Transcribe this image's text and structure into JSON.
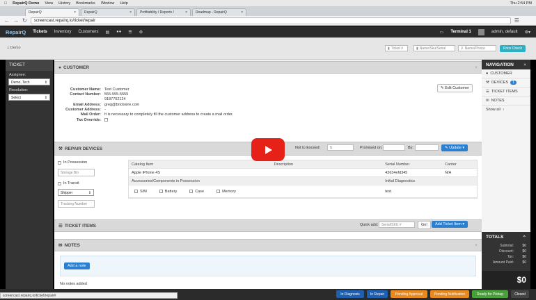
{
  "mac_bar": {
    "app": "RepairQ Demo",
    "menu": [
      "View",
      "History",
      "Bookmarks",
      "Window",
      "Help"
    ],
    "right": [
      "Thu 2:54 PM"
    ]
  },
  "browser": {
    "tabs": [
      "RepairQ",
      "RepairQ",
      "Profitability / Reports /",
      "Roadmap - RepairQ"
    ],
    "url": "screencast.repairq.io/ticket/repair",
    "status_url": "screencast.repairq.io/ticket/repair#"
  },
  "appnav": {
    "brand": "RepairQ",
    "items": [
      "Tickets",
      "Inventory",
      "Customers"
    ],
    "terminal": "Terminal 1",
    "user": "admin, default"
  },
  "toolbar": {
    "crumb": "Demo",
    "ticket_placeholder": "Ticket #",
    "sku_placeholder": "Name/Sku/Serial",
    "phone_placeholder": "Name/Phone",
    "price_check": "Price Check"
  },
  "ticket_panel": {
    "title": "TICKET",
    "assignee_label": "Assignee:",
    "assignee_value": "Demo, Tech",
    "resolution_label": "Resolution:",
    "resolution_value": "Select"
  },
  "customer": {
    "title": "CUSTOMER",
    "edit_button": "Edit Customer",
    "fields": [
      {
        "k": "Customer Name:",
        "v": "Test Customer"
      },
      {
        "k": "Contact Number:",
        "v": "555-555-5555"
      },
      {
        "k": "",
        "v": "9187702124"
      },
      {
        "k": "Email Address:",
        "v": "greg@brickwire.com"
      },
      {
        "k": "Customer Address:",
        "v": "-"
      },
      {
        "k": "Mail Order:",
        "v": "It is necessary to completely fill the customer address to create a mail order."
      },
      {
        "k": "Tax Override:",
        "v": ""
      }
    ]
  },
  "repair_devices": {
    "title": "REPAIR DEVICES",
    "not_to_exceed": "Not to Exceed:",
    "promised_on": "Promised on:",
    "by": "By:",
    "update": "Update",
    "in_possession": "In Possession",
    "storage_bin": "Storage Bin",
    "in_transit": "In Transit",
    "shipper": "Shipper",
    "tracking": "Tracking Number",
    "table": {
      "headers": [
        "Catalog Item",
        "Description",
        "Serial Number",
        "Carrier"
      ],
      "row": [
        "Apple iPhone 4S",
        "",
        "43634efd345",
        "N/A"
      ],
      "sub_headers": [
        "Accessories/Components in Possession",
        "Initial Diagnostics"
      ],
      "accessories": [
        "SIM",
        "Battery",
        "Case",
        "Memory"
      ],
      "diagnostics": "test"
    }
  },
  "ticket_items": {
    "title": "TICKET ITEMS",
    "quick_add": "Quick add:",
    "quick_placeholder": "Serial/SKU #",
    "go": "Go!",
    "add": "Add Ticket Item"
  },
  "notes": {
    "title": "NOTES",
    "add": "Add a note",
    "empty": "No notes added"
  },
  "navigation": {
    "title": "NAVIGATION",
    "items": [
      "CUSTOMER",
      "DEVICES",
      "TICKET ITEMS",
      "NOTES"
    ],
    "device_count": "1",
    "show_all": "Show all"
  },
  "totals": {
    "title": "TOTALS",
    "rows": [
      {
        "k": "Subtotal:",
        "v": "$0"
      },
      {
        "k": "Discount:",
        "v": "$0"
      },
      {
        "k": "Tax:",
        "v": "$0"
      },
      {
        "k": "Amount Paid:",
        "v": "$0"
      }
    ],
    "total": "$0"
  },
  "status_buttons": [
    {
      "label": "In Diagnosis",
      "color": "#1f5fb0"
    },
    {
      "label": "In Repair",
      "color": "#1f5fb0"
    },
    {
      "label": "Pending Approval",
      "color": "#e98a1e"
    },
    {
      "label": "Pending Notification",
      "color": "#e98a1e"
    },
    {
      "label": "Ready for Pickup",
      "color": "#4aa13c"
    },
    {
      "label": "Closed",
      "color": "#444444"
    }
  ]
}
